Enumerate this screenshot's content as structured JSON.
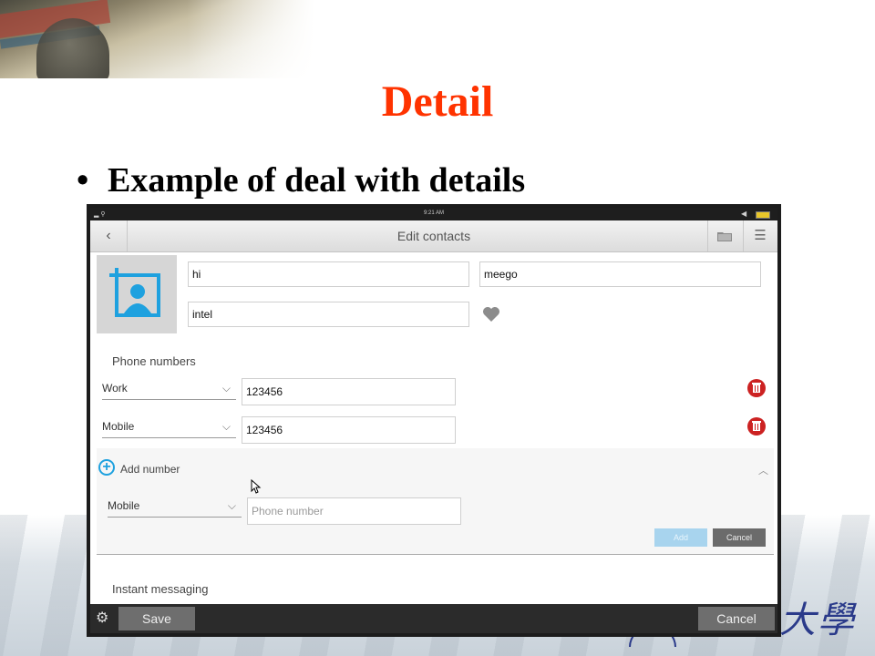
{
  "slide": {
    "title": "Detail",
    "bullet": "Example of deal with details"
  },
  "device": {
    "status_time": "9:21 AM",
    "header_title": "Edit contacts",
    "fields": {
      "first_name": "hi",
      "last_name": "meego",
      "company": "intel"
    },
    "phone_section_label": "Phone numbers",
    "phones": [
      {
        "type": "Work",
        "number": "123456"
      },
      {
        "type": "Mobile",
        "number": "123456"
      }
    ],
    "add_number": {
      "label": "Add number",
      "type": "Mobile",
      "placeholder": "Phone number",
      "add_label": "Add",
      "cancel_label": "Cancel"
    },
    "im_section_label": "Instant messaging",
    "bottom": {
      "save_label": "Save",
      "cancel_label": "Cancel"
    }
  },
  "colors": {
    "title_red": "#ff3300",
    "accent_blue": "#1ea1df",
    "delete_red": "#cc2222"
  }
}
